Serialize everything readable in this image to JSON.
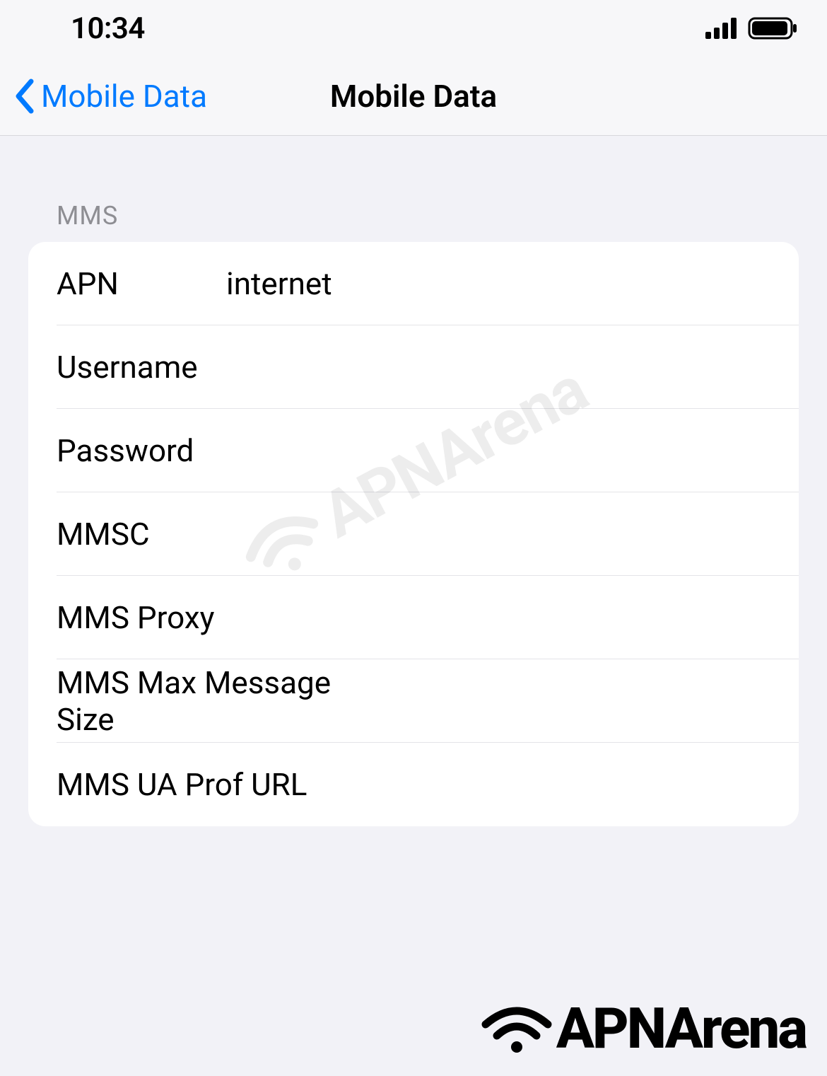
{
  "status": {
    "time": "10:34"
  },
  "nav": {
    "back_label": "Mobile Data",
    "title": "Mobile Data"
  },
  "section": {
    "header": "MMS"
  },
  "fields": {
    "apn": {
      "label": "APN",
      "value": "internet"
    },
    "username": {
      "label": "Username",
      "value": ""
    },
    "password": {
      "label": "Password",
      "value": ""
    },
    "mmsc": {
      "label": "MMSC",
      "value": ""
    },
    "mms_proxy": {
      "label": "MMS Proxy",
      "value": ""
    },
    "mms_max_size": {
      "label": "MMS Max Message Size",
      "value": ""
    },
    "mms_ua_prof": {
      "label": "MMS UA Prof URL",
      "value": ""
    }
  },
  "watermark": {
    "text": "APNArena"
  },
  "brand": {
    "text": "APNArena"
  }
}
